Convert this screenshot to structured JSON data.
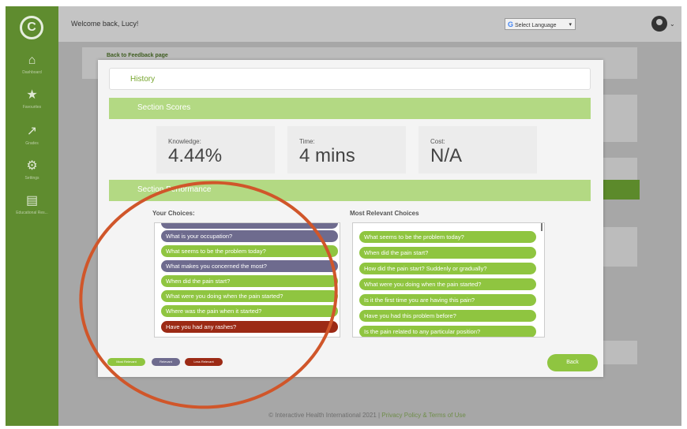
{
  "app": {
    "welcome": "Welcome back, Lucy!",
    "language_select": "Select Language",
    "language_g": "G",
    "caret": "⌄"
  },
  "sidebar": {
    "logo": "C",
    "items": [
      {
        "icon": "house-icon",
        "glyph": "⌂",
        "label": "Dashboard"
      },
      {
        "icon": "star-icon",
        "glyph": "★",
        "label": "Favourites"
      },
      {
        "icon": "chart-icon",
        "glyph": "↗",
        "label": "Grades"
      },
      {
        "icon": "gears-icon",
        "glyph": "⚙",
        "label": "Settings"
      },
      {
        "icon": "book-icon",
        "glyph": "▤",
        "label": "Educational Res..."
      }
    ]
  },
  "page": {
    "back_link": "Back to Feedback page"
  },
  "modal": {
    "title": "History",
    "section_scores": "Section Scores",
    "scores": [
      {
        "label": "Knowledge:",
        "value": "4.44%"
      },
      {
        "label": "Time:",
        "value": "4 mins"
      },
      {
        "label": "Cost:",
        "value": "N/A"
      }
    ],
    "section_performance": "Section Performance",
    "your_choices_heading": "Your Choices:",
    "most_relevant_heading": "Most Relevant Choices",
    "your_choices": [
      {
        "text": "What is your occupation?",
        "category": "rel"
      },
      {
        "text": "What seems to be the problem today?",
        "category": "most"
      },
      {
        "text": "What makes you concerned the most?",
        "category": "rel"
      },
      {
        "text": "When did the pain start?",
        "category": "most"
      },
      {
        "text": "What were you doing when the pain started?",
        "category": "most"
      },
      {
        "text": "Where was the pain when it started?",
        "category": "most"
      },
      {
        "text": "Have you had any rashes?",
        "category": "less"
      }
    ],
    "most_relevant_choices": [
      "What seems to be the problem today?",
      "When did the pain start?",
      "How did the pain start? Suddenly or gradually?",
      "What were you doing when the pain started?",
      "Is it the first time you are having this pain?",
      "Have you had this problem before?",
      "Is the pain related to any particular position?"
    ],
    "legend": {
      "most": "Most Relevant",
      "relevant": "Relevant",
      "less": "Less Relevant"
    },
    "back_button": "Back"
  },
  "footer": {
    "copyright": "© Interactive Health International 2021 | ",
    "privacy": "Privacy Policy",
    "amp": " & ",
    "terms": "Terms of Use"
  },
  "colors": {
    "sidebar": "#5f8c2f",
    "most_relevant": "#8fc540",
    "relevant": "#6e6b8e",
    "less_relevant": "#9c2a15",
    "section_bar": "#b3d983",
    "annotation_circle": "#d0562a"
  }
}
